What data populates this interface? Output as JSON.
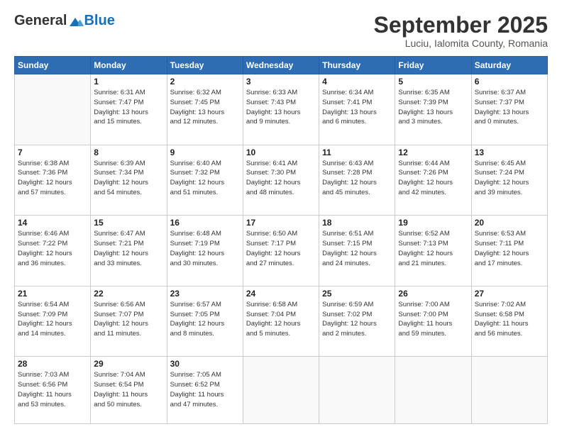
{
  "header": {
    "logo_general": "General",
    "logo_blue": "Blue",
    "month": "September 2025",
    "location": "Luciu, Ialomita County, Romania"
  },
  "days_of_week": [
    "Sunday",
    "Monday",
    "Tuesday",
    "Wednesday",
    "Thursday",
    "Friday",
    "Saturday"
  ],
  "weeks": [
    [
      {
        "day": "",
        "info": ""
      },
      {
        "day": "1",
        "info": "Sunrise: 6:31 AM\nSunset: 7:47 PM\nDaylight: 13 hours\nand 15 minutes."
      },
      {
        "day": "2",
        "info": "Sunrise: 6:32 AM\nSunset: 7:45 PM\nDaylight: 13 hours\nand 12 minutes."
      },
      {
        "day": "3",
        "info": "Sunrise: 6:33 AM\nSunset: 7:43 PM\nDaylight: 13 hours\nand 9 minutes."
      },
      {
        "day": "4",
        "info": "Sunrise: 6:34 AM\nSunset: 7:41 PM\nDaylight: 13 hours\nand 6 minutes."
      },
      {
        "day": "5",
        "info": "Sunrise: 6:35 AM\nSunset: 7:39 PM\nDaylight: 13 hours\nand 3 minutes."
      },
      {
        "day": "6",
        "info": "Sunrise: 6:37 AM\nSunset: 7:37 PM\nDaylight: 13 hours\nand 0 minutes."
      }
    ],
    [
      {
        "day": "7",
        "info": "Sunrise: 6:38 AM\nSunset: 7:36 PM\nDaylight: 12 hours\nand 57 minutes."
      },
      {
        "day": "8",
        "info": "Sunrise: 6:39 AM\nSunset: 7:34 PM\nDaylight: 12 hours\nand 54 minutes."
      },
      {
        "day": "9",
        "info": "Sunrise: 6:40 AM\nSunset: 7:32 PM\nDaylight: 12 hours\nand 51 minutes."
      },
      {
        "day": "10",
        "info": "Sunrise: 6:41 AM\nSunset: 7:30 PM\nDaylight: 12 hours\nand 48 minutes."
      },
      {
        "day": "11",
        "info": "Sunrise: 6:43 AM\nSunset: 7:28 PM\nDaylight: 12 hours\nand 45 minutes."
      },
      {
        "day": "12",
        "info": "Sunrise: 6:44 AM\nSunset: 7:26 PM\nDaylight: 12 hours\nand 42 minutes."
      },
      {
        "day": "13",
        "info": "Sunrise: 6:45 AM\nSunset: 7:24 PM\nDaylight: 12 hours\nand 39 minutes."
      }
    ],
    [
      {
        "day": "14",
        "info": "Sunrise: 6:46 AM\nSunset: 7:22 PM\nDaylight: 12 hours\nand 36 minutes."
      },
      {
        "day": "15",
        "info": "Sunrise: 6:47 AM\nSunset: 7:21 PM\nDaylight: 12 hours\nand 33 minutes."
      },
      {
        "day": "16",
        "info": "Sunrise: 6:48 AM\nSunset: 7:19 PM\nDaylight: 12 hours\nand 30 minutes."
      },
      {
        "day": "17",
        "info": "Sunrise: 6:50 AM\nSunset: 7:17 PM\nDaylight: 12 hours\nand 27 minutes."
      },
      {
        "day": "18",
        "info": "Sunrise: 6:51 AM\nSunset: 7:15 PM\nDaylight: 12 hours\nand 24 minutes."
      },
      {
        "day": "19",
        "info": "Sunrise: 6:52 AM\nSunset: 7:13 PM\nDaylight: 12 hours\nand 21 minutes."
      },
      {
        "day": "20",
        "info": "Sunrise: 6:53 AM\nSunset: 7:11 PM\nDaylight: 12 hours\nand 17 minutes."
      }
    ],
    [
      {
        "day": "21",
        "info": "Sunrise: 6:54 AM\nSunset: 7:09 PM\nDaylight: 12 hours\nand 14 minutes."
      },
      {
        "day": "22",
        "info": "Sunrise: 6:56 AM\nSunset: 7:07 PM\nDaylight: 12 hours\nand 11 minutes."
      },
      {
        "day": "23",
        "info": "Sunrise: 6:57 AM\nSunset: 7:05 PM\nDaylight: 12 hours\nand 8 minutes."
      },
      {
        "day": "24",
        "info": "Sunrise: 6:58 AM\nSunset: 7:04 PM\nDaylight: 12 hours\nand 5 minutes."
      },
      {
        "day": "25",
        "info": "Sunrise: 6:59 AM\nSunset: 7:02 PM\nDaylight: 12 hours\nand 2 minutes."
      },
      {
        "day": "26",
        "info": "Sunrise: 7:00 AM\nSunset: 7:00 PM\nDaylight: 11 hours\nand 59 minutes."
      },
      {
        "day": "27",
        "info": "Sunrise: 7:02 AM\nSunset: 6:58 PM\nDaylight: 11 hours\nand 56 minutes."
      }
    ],
    [
      {
        "day": "28",
        "info": "Sunrise: 7:03 AM\nSunset: 6:56 PM\nDaylight: 11 hours\nand 53 minutes."
      },
      {
        "day": "29",
        "info": "Sunrise: 7:04 AM\nSunset: 6:54 PM\nDaylight: 11 hours\nand 50 minutes."
      },
      {
        "day": "30",
        "info": "Sunrise: 7:05 AM\nSunset: 6:52 PM\nDaylight: 11 hours\nand 47 minutes."
      },
      {
        "day": "",
        "info": ""
      },
      {
        "day": "",
        "info": ""
      },
      {
        "day": "",
        "info": ""
      },
      {
        "day": "",
        "info": ""
      }
    ]
  ]
}
